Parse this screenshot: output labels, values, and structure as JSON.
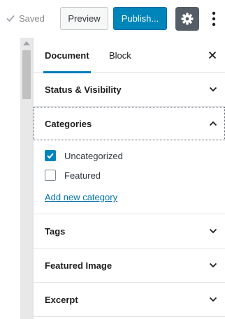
{
  "toolbar": {
    "saved_label": "Saved",
    "preview_label": "Preview",
    "publish_label": "Publish..."
  },
  "sidebar": {
    "tabs": [
      {
        "label": "Document",
        "active": true
      },
      {
        "label": "Block",
        "active": false
      }
    ],
    "panels": {
      "status": {
        "title": "Status & Visibility",
        "expanded": false
      },
      "categories": {
        "title": "Categories",
        "expanded": true,
        "items": [
          {
            "label": "Uncategorized",
            "checked": true
          },
          {
            "label": "Featured",
            "checked": false
          }
        ],
        "add_link": "Add new category"
      },
      "tags": {
        "title": "Tags",
        "expanded": false
      },
      "featured_image": {
        "title": "Featured Image",
        "expanded": false
      },
      "excerpt": {
        "title": "Excerpt",
        "expanded": false
      }
    }
  },
  "colors": {
    "accent": "#0085ba",
    "link": "#0073aa",
    "settings_bg": "#555d66"
  },
  "icons": {
    "saved": "checkmark-icon",
    "settings": "gear-icon",
    "more": "vertical-ellipsis-icon",
    "close": "close-icon",
    "collapsed": "chevron-down-icon",
    "expanded": "chevron-up-icon"
  }
}
